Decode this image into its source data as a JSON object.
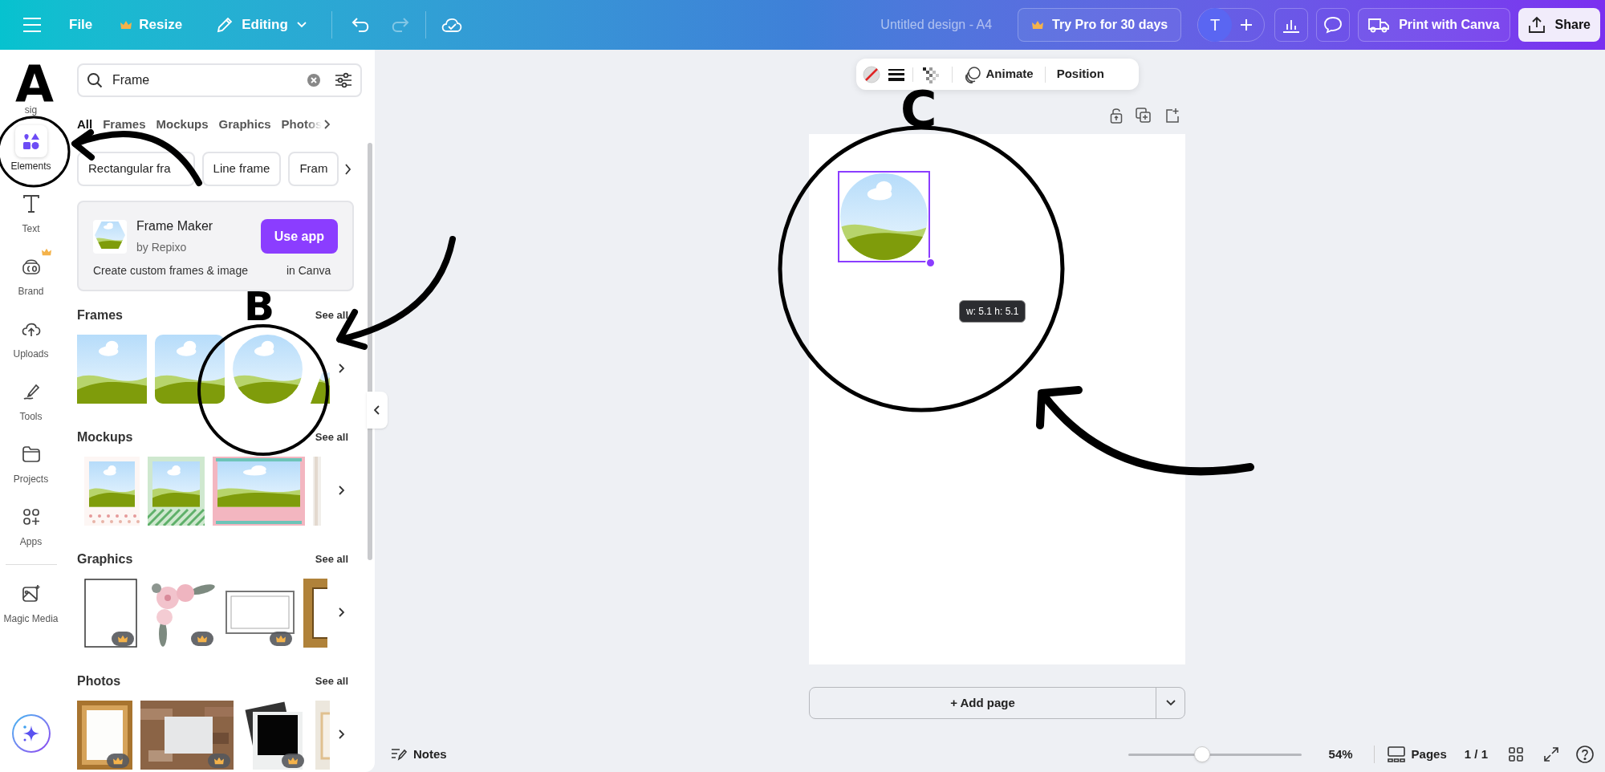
{
  "toolbar": {
    "menu": [
      {
        "label": "File",
        "pro": false
      },
      {
        "label": "Resize",
        "pro": true
      }
    ],
    "mode": "Editing",
    "undo_enabled": true,
    "redo_enabled": false,
    "title": "Untitled design - A4",
    "try_pro": "Try Pro for 30 days",
    "avatar": "T",
    "print": "Print with Canva",
    "share": "Share"
  },
  "rail": [
    {
      "label": "sig",
      "selected": false,
      "pro": false
    },
    {
      "label": "Elements",
      "selected": true,
      "pro": false
    },
    {
      "label": "Text",
      "selected": false,
      "pro": false
    },
    {
      "label": "Brand",
      "selected": false,
      "pro": true
    },
    {
      "label": "Uploads",
      "selected": false,
      "pro": false
    },
    {
      "label": "Tools",
      "selected": false,
      "pro": false
    },
    {
      "label": "Projects",
      "selected": false,
      "pro": false
    },
    {
      "label": "Apps",
      "selected": false,
      "pro": false
    },
    {
      "label": "Magic Media",
      "selected": false,
      "pro": false
    }
  ],
  "search": {
    "value": "Frame"
  },
  "filter_tabs": [
    {
      "label": "All",
      "selected": true
    },
    {
      "label": "Frames",
      "selected": false
    },
    {
      "label": "Mockups",
      "selected": false
    },
    {
      "label": "Graphics",
      "selected": false
    },
    {
      "label": "Photos",
      "selected": false
    }
  ],
  "chips": [
    "Rectangular fra",
    "Line frame",
    "Fram"
  ],
  "app_card": {
    "name": "Frame Maker",
    "by": "by Repixo",
    "button": "Use app",
    "description_start": "Create custom frames & image",
    "description_end": "in Canva"
  },
  "sections": [
    {
      "title": "Frames",
      "see_all": "See all",
      "items": [
        {
          "kind": "frame"
        },
        {
          "kind": "frame"
        },
        {
          "kind": "frame"
        },
        {
          "kind": "frame"
        }
      ]
    },
    {
      "title": "Mockups",
      "see_all": "See all",
      "items": [
        {
          "kind": "mockup"
        },
        {
          "kind": "mockup"
        },
        {
          "kind": "mockup"
        },
        {
          "kind": "mockup"
        }
      ]
    },
    {
      "title": "Graphics",
      "see_all": "See all",
      "items": [
        {
          "kind": "graphic",
          "pro": true
        },
        {
          "kind": "graphic",
          "pro": true
        },
        {
          "kind": "graphic",
          "pro": true
        },
        {
          "kind": "graphic"
        }
      ]
    },
    {
      "title": "Photos",
      "see_all": "See all",
      "items": [
        {
          "kind": "picture",
          "pro": true
        },
        {
          "kind": "picture",
          "pro": true
        },
        {
          "kind": "picture",
          "pro": true
        },
        {
          "kind": "picture"
        }
      ]
    }
  ],
  "element_toolbar": {
    "animate": "Animate",
    "position": "Position"
  },
  "selection": {
    "dimensions": "w: 5.1 h: 5.1"
  },
  "add_page": "+ Add page",
  "status_bar": {
    "notes": "Notes",
    "zoom": {
      "level": 0.43,
      "reading": "54%"
    },
    "pages": "Pages",
    "page_count": "1 / 1"
  },
  "annotations": [
    {
      "letter": "A"
    },
    {
      "letter": "B"
    },
    {
      "letter": "C"
    }
  ]
}
